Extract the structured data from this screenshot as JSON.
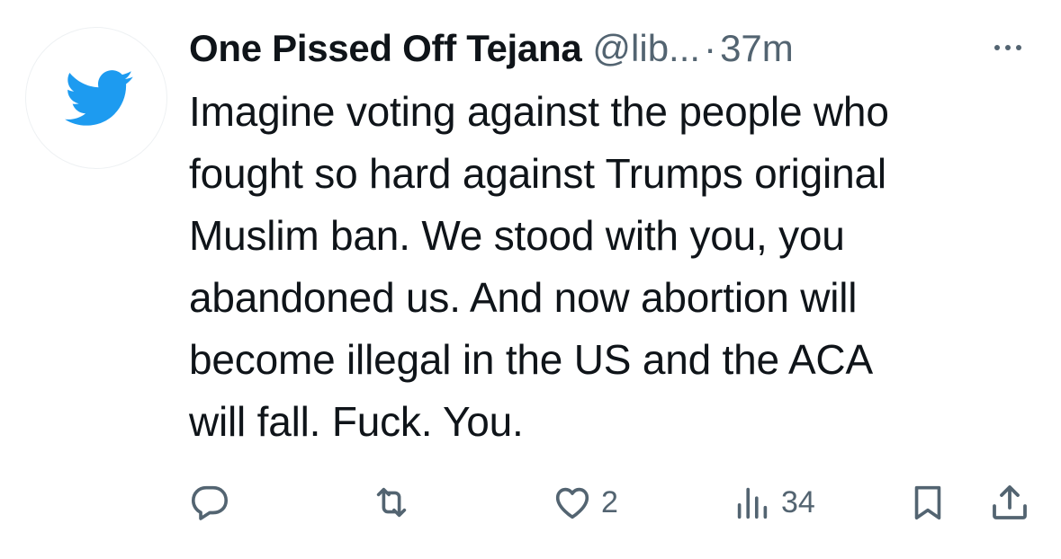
{
  "tweet": {
    "display_name": "One Pissed Off Tejana",
    "handle": "@lib...",
    "separator": "·",
    "time": "37m",
    "text": "Imagine voting against the people who\nfought so hard against Trumps original\nMuslim ban. We stood with you, you\nabandoned us.  And now abortion will\nbecome illegal in the US and the ACA\nwill fall.  Fuck. You.",
    "avatar_icon": "twitter-bird-icon"
  },
  "actions": {
    "reply": {
      "icon": "reply-icon",
      "count": ""
    },
    "retweet": {
      "icon": "retweet-icon",
      "count": ""
    },
    "like": {
      "icon": "heart-icon",
      "count": "2"
    },
    "views": {
      "icon": "views-icon",
      "count": "34"
    },
    "bookmark": {
      "icon": "bookmark-icon"
    },
    "share": {
      "icon": "share-icon"
    }
  },
  "colors": {
    "brand_blue": "#1d9bf0",
    "text": "#0f1419",
    "secondary": "#536471"
  }
}
